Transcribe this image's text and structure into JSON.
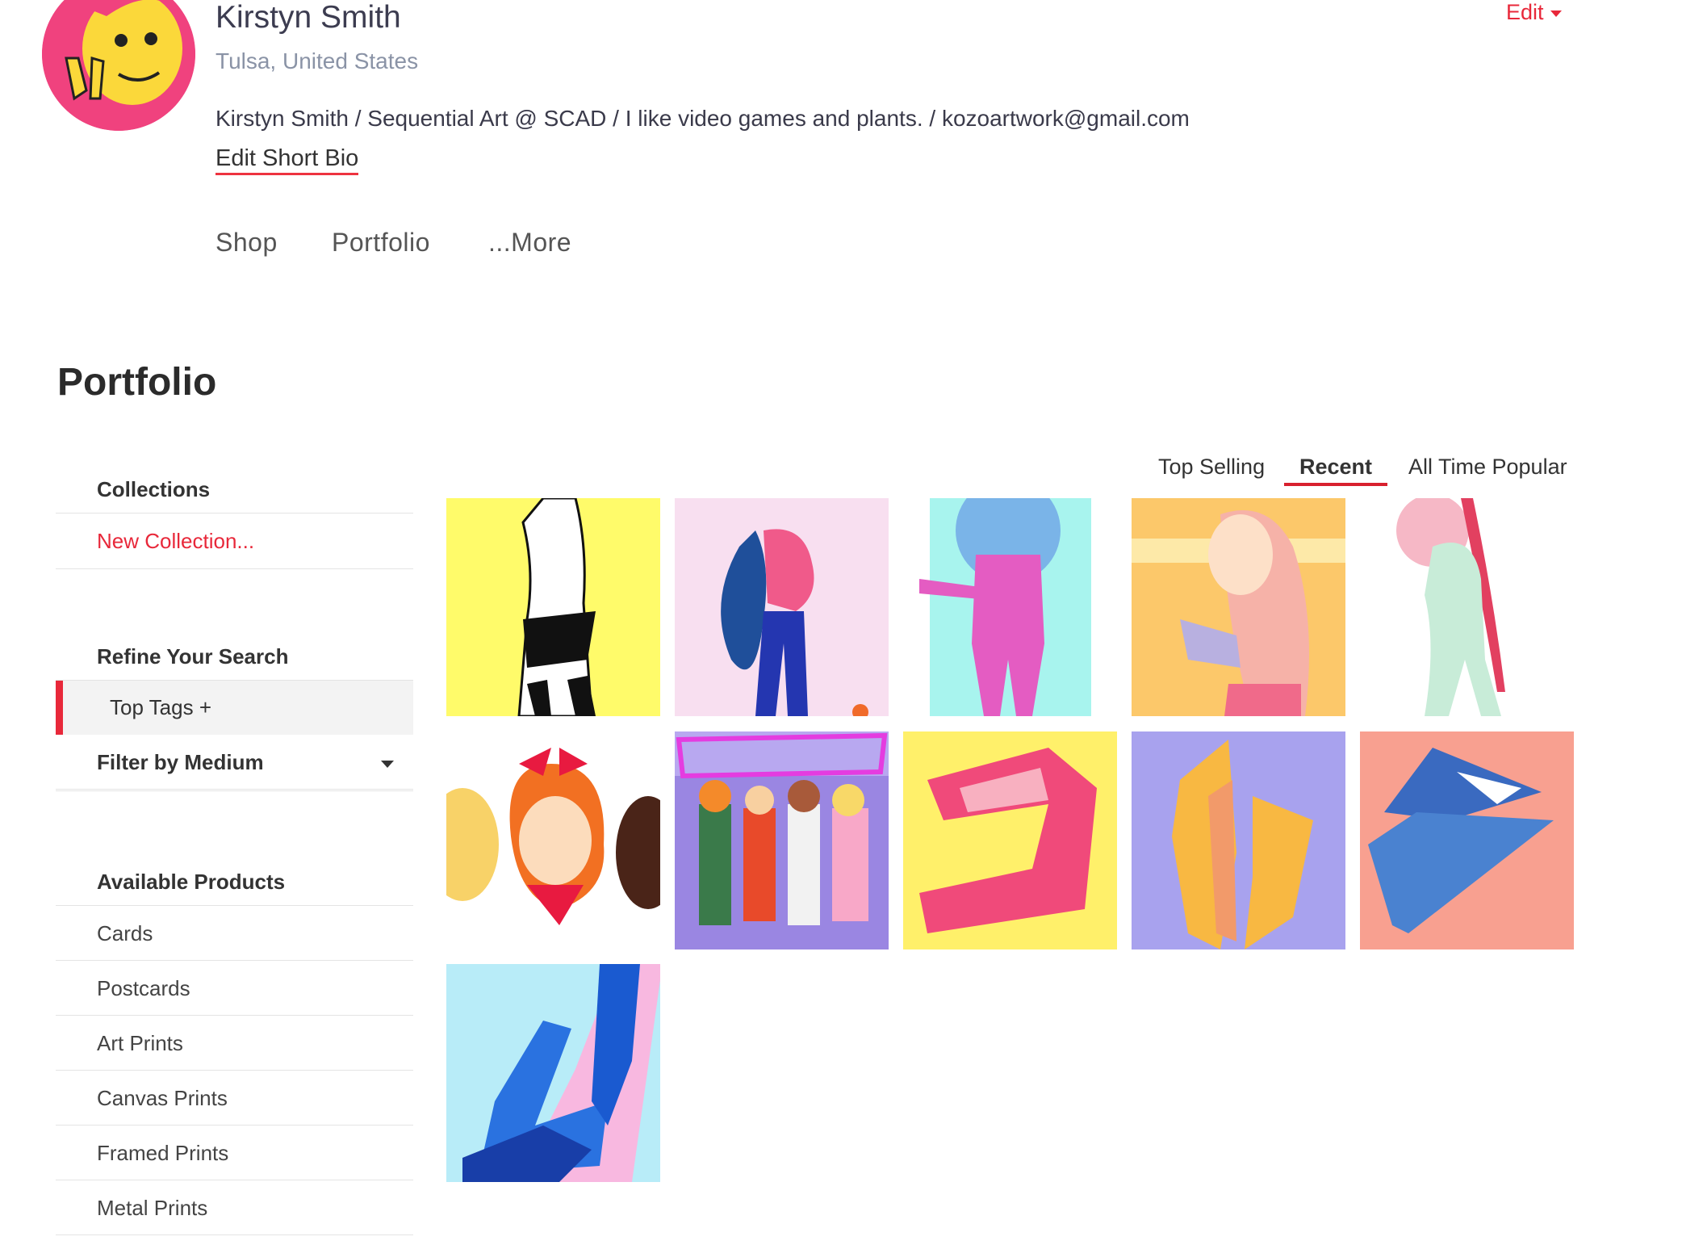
{
  "profile": {
    "name": "Kirstyn Smith",
    "location": "Tulsa, United States",
    "bio": "Kirstyn Smith / Sequential Art @ SCAD / I like video games and plants. / kozoartwork@gmail.com",
    "edit_bio_label": "Edit Short Bio",
    "edit_label": "Edit"
  },
  "nav": {
    "shop": "Shop",
    "portfolio": "Portfolio",
    "more": "...More"
  },
  "section_title": "Portfolio",
  "sidebar": {
    "collections_header": "Collections",
    "new_collection": "New Collection...",
    "refine_header": "Refine Your Search",
    "top_tags": "Top Tags +",
    "filter_medium": "Filter by Medium",
    "products_header": "Available Products",
    "products": [
      "Cards",
      "Postcards",
      "Art Prints",
      "Canvas Prints",
      "Framed Prints",
      "Metal Prints"
    ]
  },
  "sort": {
    "top_selling": "Top Selling",
    "recent": "Recent",
    "all_time": "All Time Popular",
    "active": "Recent"
  },
  "colors": {
    "accent": "#e8283a",
    "text_dark": "#333333",
    "location_gray": "#8a93a6"
  },
  "gallery": {
    "artworks": [
      {
        "bg": "#fffb6a"
      },
      {
        "bg": "#f8dff0"
      },
      {
        "bg": "#a8f4ee"
      },
      {
        "bg": "#fcc86a"
      },
      {
        "bg": "#ffffff"
      },
      {
        "bg": "#ffffff"
      },
      {
        "bg": "#9a86e2"
      },
      {
        "bg": "#fff06a"
      },
      {
        "bg": "#a8a2ee"
      },
      {
        "bg": "#f8a090"
      },
      {
        "bg": "#b8ecf8"
      }
    ]
  }
}
